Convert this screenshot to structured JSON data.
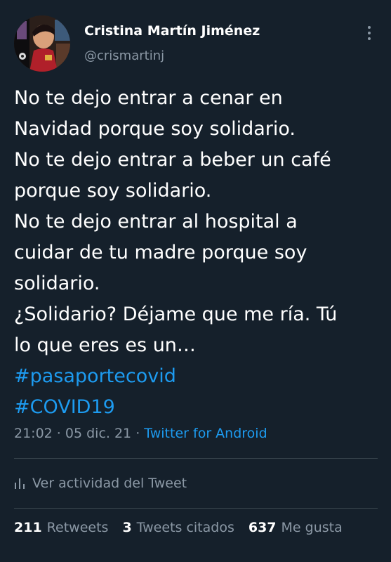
{
  "author": {
    "name": "Cristina Martín Jiménez",
    "handle": "@crismartinj"
  },
  "tweet": {
    "lines": [
      "No te dejo entrar a cenar en",
      "Navidad porque soy solidario.",
      "No te dejo entrar a beber un café",
      "porque soy solidario.",
      "No te dejo entrar al hospital a",
      "cuidar de tu madre porque soy",
      "solidario.",
      "¿Solidario? Déjame que me ría. Tú",
      "lo que eres es un…"
    ],
    "hashtags": [
      "#pasaportecovid",
      "#COVID19"
    ]
  },
  "meta": {
    "time": "21:02",
    "separator": " · ",
    "date": "05 dic. 21",
    "source": "Twitter for Android"
  },
  "activity": {
    "icon": "bar-chart-icon",
    "label": "Ver actividad del Tweet"
  },
  "stats": {
    "retweets_count": "211",
    "retweets_label": "Retweets",
    "quotes_count": "3",
    "quotes_label": "Tweets citados",
    "likes_count": "637",
    "likes_label": "Me gusta"
  },
  "colors": {
    "background": "#15202b",
    "text": "#ffffff",
    "secondary": "#8b98a5",
    "link": "#1d9bf0",
    "divider": "#38444d"
  }
}
